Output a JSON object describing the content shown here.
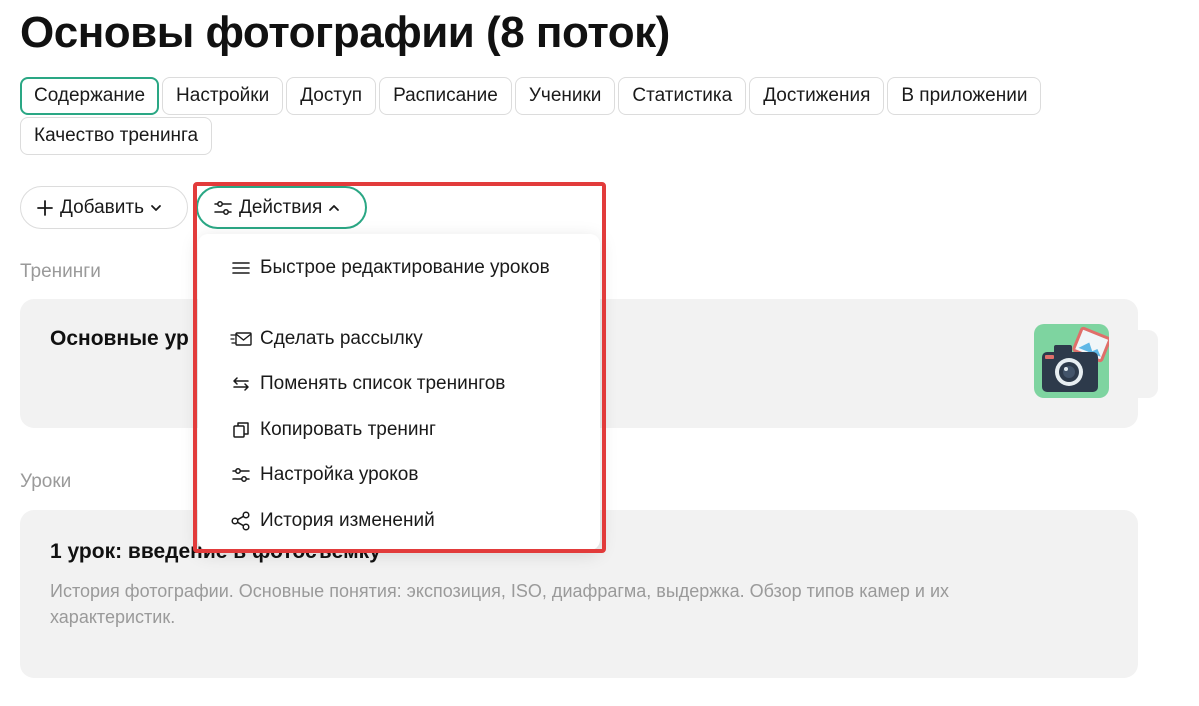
{
  "page": {
    "title": "Основы фотографии (8 поток)"
  },
  "tabs": [
    {
      "label": "Содержание",
      "active": true
    },
    {
      "label": "Настройки"
    },
    {
      "label": "Доступ"
    },
    {
      "label": "Расписание"
    },
    {
      "label": "Ученики"
    },
    {
      "label": "Статистика"
    },
    {
      "label": "Достижения"
    },
    {
      "label": "В приложении"
    },
    {
      "label": "Качество тренинга"
    }
  ],
  "toolbar": {
    "add_label": "Добавить",
    "actions_label": "Действия"
  },
  "actions_menu": {
    "items": [
      {
        "label": "Быстрое редактирование уроков",
        "icon": "list-icon"
      },
      {
        "label": "Сделать рассылку",
        "icon": "mail-icon"
      },
      {
        "label": "Поменять список тренингов",
        "icon": "swap-icon"
      },
      {
        "label": "Копировать тренинг",
        "icon": "copy-icon"
      },
      {
        "label": "Настройка уроков",
        "icon": "sliders-icon"
      },
      {
        "label": "История изменений",
        "icon": "share-icon"
      }
    ]
  },
  "trainings": {
    "section_label": "Тренинги",
    "items": [
      {
        "title": "Основные ур",
        "image": "camera-icon"
      }
    ]
  },
  "lessons": {
    "section_label": "Уроки",
    "items": [
      {
        "title": "1 урок: введение в фотосъемку",
        "description": "История фотографии. Основные понятия: экспозиция, ISO, диафрагма, выдержка. Обзор типов камер и их характеристик."
      }
    ]
  },
  "colors": {
    "accent": "#2aa784",
    "highlight": "#e23b3b",
    "card_bg": "#f2f2f2",
    "muted_text": "#9a9a9a",
    "camera_tile": "#7ed4a0"
  }
}
